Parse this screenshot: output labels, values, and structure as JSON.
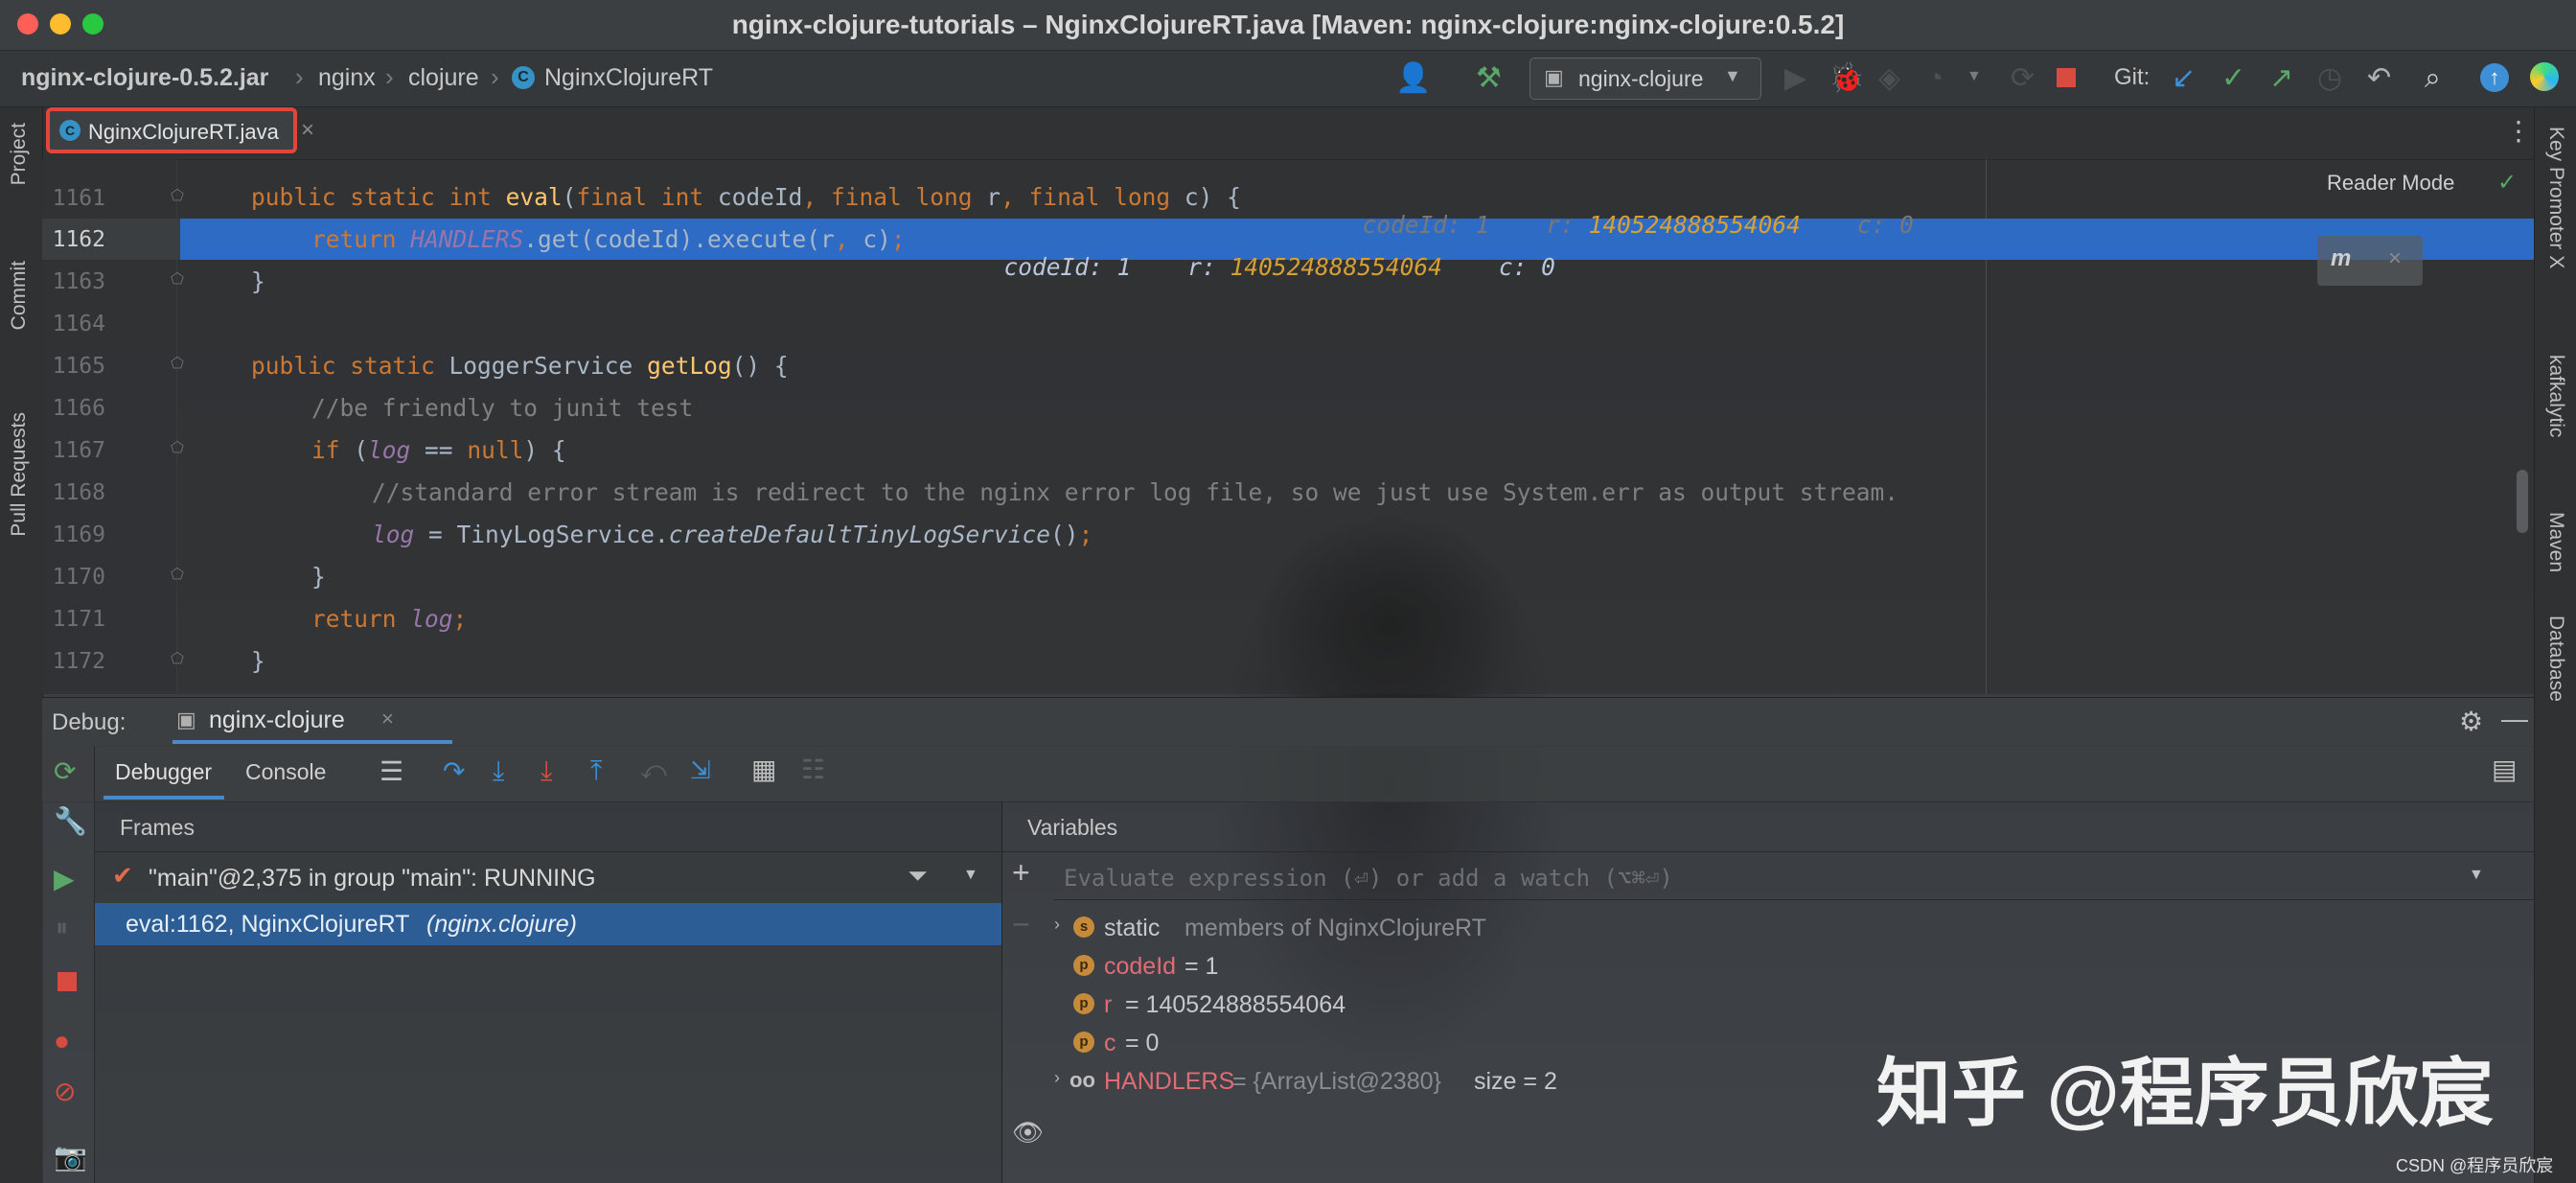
{
  "window": {
    "title": "nginx-clojure-tutorials – NginxClojureRT.java [Maven: nginx-clojure:nginx-clojure:0.5.2]"
  },
  "breadcrumbs": [
    "nginx-clojure-0.5.2.jar",
    "nginx",
    "clojure",
    "NginxClojureRT"
  ],
  "toolbar": {
    "run_config": "nginx-clojure",
    "git_label": "Git:"
  },
  "tabs": [
    {
      "label": "NginxClojureRT.java",
      "active": true
    }
  ],
  "left_stripe": [
    "Project",
    "Commit",
    "Pull Requests"
  ],
  "right_stripe": [
    "Key Promoter X",
    "kafkalytic",
    "Maven",
    "Database"
  ],
  "editor": {
    "reader_mode": "Reader Mode",
    "current_line": 1162,
    "lines": [
      {
        "n": "1161",
        "text": "public static int eval(final int codeId, final long r, final long c) {"
      },
      {
        "n": "1162",
        "text": "return HANDLERS.get(codeId).execute(r, c);"
      },
      {
        "n": "1163",
        "text": "}"
      },
      {
        "n": "1164",
        "text": ""
      },
      {
        "n": "1165",
        "text": "public static LoggerService getLog() {"
      },
      {
        "n": "1166",
        "text": "//be friendly to junit test"
      },
      {
        "n": "1167",
        "text": "if (log == null) {"
      },
      {
        "n": "1168",
        "text": "//standard error stream is redirect to the nginx error log file, so we just use System.err as output stream."
      },
      {
        "n": "1169",
        "text": "log = TinyLogService.createDefaultTinyLogService();"
      },
      {
        "n": "1170",
        "text": "}"
      },
      {
        "n": "1171",
        "text": "return log;"
      },
      {
        "n": "1172",
        "text": "}"
      }
    ],
    "inline_hints": {
      "codeId": "codeId: 1",
      "r_label": "r:",
      "r_value": "140524888554064",
      "c": "c: 0"
    }
  },
  "debug": {
    "label": "Debug:",
    "session": "nginx-clojure",
    "tabs": [
      "Debugger",
      "Console"
    ],
    "frames_title": "Frames",
    "thread": "\"main\"@2,375 in group \"main\": RUNNING",
    "frame": "eval:1162, NginxClojureRT",
    "frame_pkg": "(nginx.clojure)",
    "variables_title": "Variables",
    "watch_placeholder": "Evaluate expression (⏎) or add a watch (⌥⌘⏎)",
    "variables": [
      {
        "icon": "s",
        "name": "static",
        "value": "members of NginxClojureRT"
      },
      {
        "icon": "p",
        "name": "codeId",
        "value": "= 1"
      },
      {
        "icon": "p",
        "name": "r",
        "value": "= 140524888554064"
      },
      {
        "icon": "p",
        "name": "c",
        "value": "= 0"
      },
      {
        "icon": "oo",
        "name": "HANDLERS",
        "value": "= {ArrayList@2380}",
        "extra": "size = 2"
      }
    ]
  },
  "watermark": {
    "main": "知乎 @程序员欣宸",
    "corner": "CSDN @程序员欣宸"
  },
  "colors": {
    "selection": "#2e6bc4",
    "tab_highlight": "#e0463b",
    "keyword": "#cc7832"
  }
}
